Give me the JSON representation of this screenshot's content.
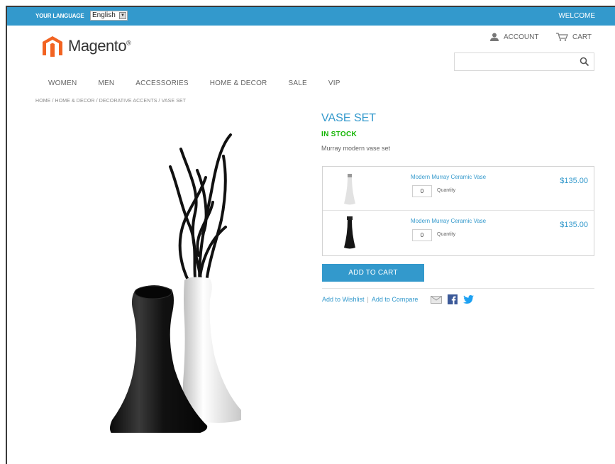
{
  "topbar": {
    "language_label": "YOUR LANGUAGE",
    "language_value": "English",
    "welcome": "WELCOME"
  },
  "logo": {
    "text": "Magento"
  },
  "header": {
    "account_label": "ACCOUNT",
    "cart_label": "CART",
    "search_placeholder": ""
  },
  "nav": {
    "items": [
      "WOMEN",
      "MEN",
      "ACCESSORIES",
      "HOME & DECOR",
      "SALE",
      "VIP"
    ]
  },
  "breadcrumb": "HOME / HOME & DECOR / DECORATIVE ACCENTS / VASE SET",
  "product": {
    "title": "VASE SET",
    "stock": "IN STOCK",
    "description": "Murray modern vase set",
    "items": [
      {
        "name": "Modern Murray Ceramic Vase",
        "qty": "0",
        "qty_label": "Quantity",
        "price": "$135.00",
        "color": "#e2e2e2"
      },
      {
        "name": "Modern Murray Ceramic Vase",
        "qty": "0",
        "qty_label": "Quantity",
        "price": "$135.00",
        "color": "#151515"
      }
    ],
    "add_to_cart": "ADD TO CART",
    "wishlist": "Add to Wishlist",
    "compare": "Add to Compare"
  },
  "colors": {
    "accent": "#3399cc",
    "in_stock": "#11b400"
  }
}
